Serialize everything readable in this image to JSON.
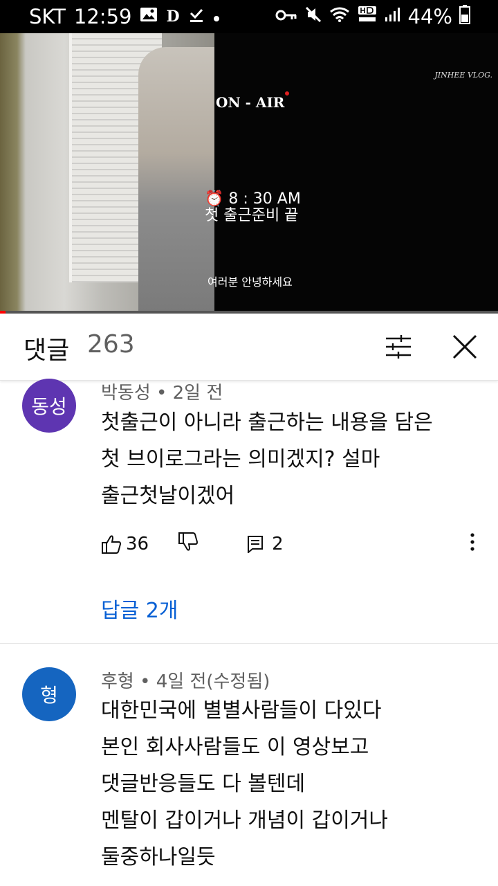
{
  "status_bar": {
    "carrier": "SKT",
    "time": "12:59",
    "battery": "44%"
  },
  "video": {
    "overlay_title": "ON - AIR",
    "credit": "JINHEE VLOG.",
    "time_text": "8 : 30 AM",
    "caption": "첫 출근준비 끝",
    "subtitle": "여러분 안녕하세요",
    "progress": 0.011
  },
  "comments_header": {
    "title": "댓글",
    "count": "263"
  },
  "comments": [
    {
      "avatar_text": "동성",
      "avatar_color": "#5e35b1",
      "author": "박동성",
      "time": "2일 전",
      "lines": [
        "첫출근이 아니라 출근하는 내용을 담은",
        "첫 브이로그라는 의미겠지? 설마",
        "출근첫날이겠어"
      ],
      "likes": "36",
      "reply_count": "2",
      "replies_link": "답글 2개"
    },
    {
      "avatar_text": "형",
      "avatar_color": "#1565c0",
      "author": "후형",
      "time": "4일 전(수정됨)",
      "lines": [
        "대한민국에 별별사람들이 다있다",
        "본인 회사사람들도 이 영상보고",
        "댓글반응들도 다 볼텐데",
        "멘탈이 갑이거나 개념이 갑이거나",
        "둘중하나일듯"
      ]
    }
  ]
}
